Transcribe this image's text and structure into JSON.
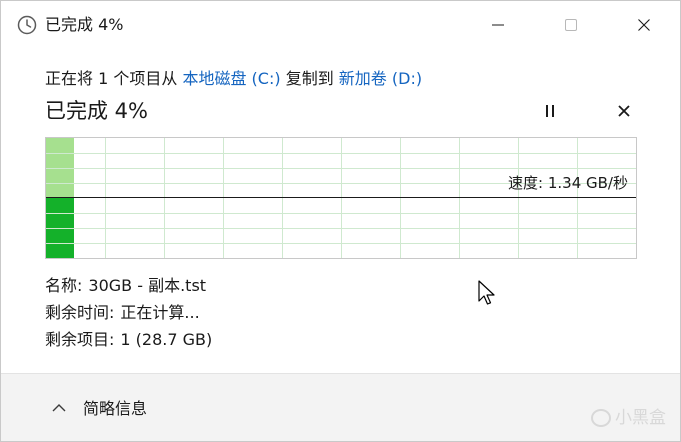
{
  "window": {
    "title": "已完成 4%"
  },
  "copy": {
    "prefix": "正在将 1 个项目从",
    "source": "本地磁盘 (C:)",
    "middle": "复制到",
    "destination": "新加卷 (D:)"
  },
  "progress": {
    "status": "已完成 4%",
    "percent": 4,
    "speed_label": "速度: 1.34 GB/秒"
  },
  "details": {
    "name_label": "名称:",
    "name_value": "30GB - 副本.tst",
    "time_label": "剩余时间:",
    "time_value": "正在计算...",
    "items_label": "剩余项目:",
    "items_value": "1 (28.7 GB)"
  },
  "footer": {
    "toggle_label": "简略信息"
  },
  "watermark": {
    "text": "小黑盒"
  },
  "colors": {
    "accent": "#1565c0",
    "graph_fill_light": "#a6e08f",
    "graph_fill_dark": "#14b12a",
    "grid": "#cfe9cf"
  },
  "icons": {
    "title": "clock-icon",
    "pause": "pause-icon",
    "stop": "close-icon",
    "toggle": "chevron-up-icon"
  }
}
